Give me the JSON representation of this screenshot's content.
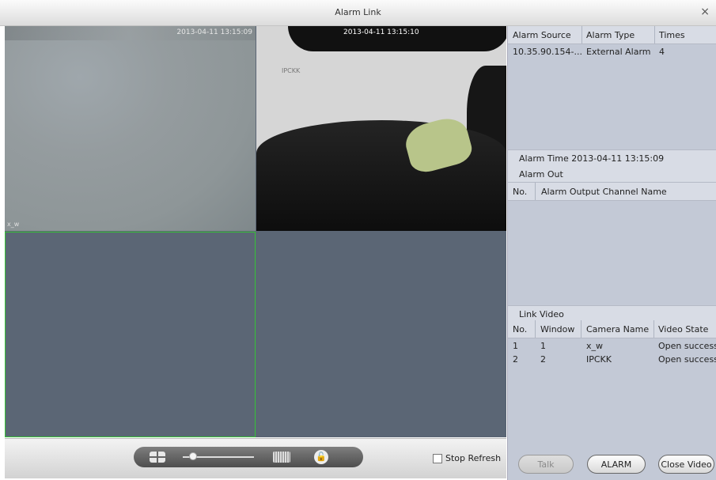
{
  "window": {
    "title": "Alarm Link",
    "close": "×"
  },
  "video": {
    "cells": [
      {
        "timestamp": "2013-04-11 13:15:09",
        "label": "x_w"
      },
      {
        "timestamp": "2013-04-11 13:15:10",
        "label": "IPCKK"
      }
    ]
  },
  "controls": {
    "lock_glyph": "🔓",
    "stop_refresh": "Stop Refresh"
  },
  "alarm_table": {
    "headers": [
      "Alarm Source",
      "Alarm Type",
      "Times"
    ],
    "rows": [
      [
        "10.35.90.154-...",
        "External Alarm",
        "4"
      ]
    ]
  },
  "alarm_time": {
    "label": "Alarm Time",
    "value": "2013-04-11 13:15:09"
  },
  "alarm_out": {
    "section": "Alarm Out",
    "headers": [
      "No.",
      "Alarm Output Channel Name"
    ]
  },
  "link_video": {
    "section": "Link Video",
    "headers": [
      "No.",
      "Window",
      "Camera Name",
      "Video State"
    ],
    "rows": [
      [
        "1",
        "1",
        "x_w",
        "Open success"
      ],
      [
        "2",
        "2",
        "IPCKK",
        "Open success"
      ]
    ]
  },
  "buttons": {
    "talk": "Talk",
    "alarm": "ALARM",
    "close_video": "Close Video"
  }
}
